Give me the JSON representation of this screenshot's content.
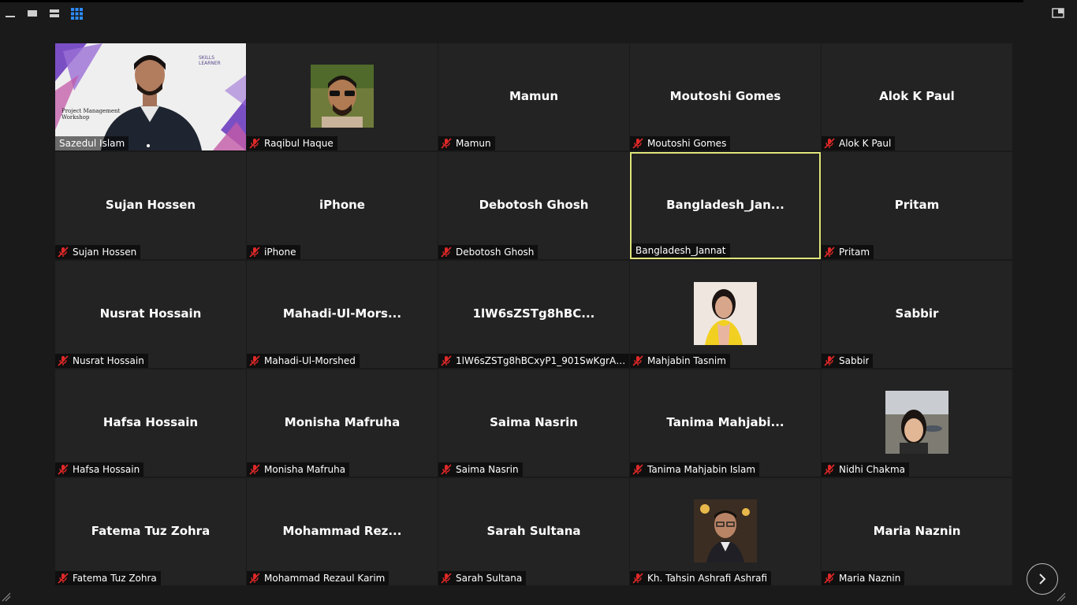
{
  "window": {
    "view_buttons": [
      "minimize-icon",
      "speaker-view-icon",
      "strip-view-icon",
      "gallery-view-icon"
    ],
    "exit_fullscreen_icon": "exit-fullscreen-icon",
    "accent_color": "#2d8cff",
    "active_speaker_border": "#dfe57a"
  },
  "participants": [
    {
      "name": "Sazedul Islam",
      "display": "",
      "kind": "video",
      "muted": false
    },
    {
      "name": "Raqibul Haque",
      "display": "",
      "kind": "photo",
      "muted": true,
      "photo": "man-sunglasses"
    },
    {
      "name": "Mamun",
      "display": "Mamun",
      "kind": "name",
      "muted": true
    },
    {
      "name": "Moutoshi Gomes",
      "display": "Moutoshi Gomes",
      "kind": "name",
      "muted": true
    },
    {
      "name": "Alok K Paul",
      "display": "Alok K Paul",
      "kind": "name",
      "muted": true
    },
    {
      "name": "Sujan Hossen",
      "display": "Sujan Hossen",
      "kind": "name",
      "muted": true
    },
    {
      "name": "iPhone",
      "display": "iPhone",
      "kind": "name",
      "muted": true
    },
    {
      "name": "Debotosh Ghosh",
      "display": "Debotosh Ghosh",
      "kind": "name",
      "muted": true
    },
    {
      "name": "Bangladesh_Jannat",
      "display": "Bangladesh_Jan...",
      "kind": "name",
      "muted": false,
      "active": true
    },
    {
      "name": "Pritam",
      "display": "Pritam",
      "kind": "name",
      "muted": true
    },
    {
      "name": "Nusrat Hossain",
      "display": "Nusrat Hossain",
      "kind": "name",
      "muted": true
    },
    {
      "name": "Mahadi-Ul-Morshed",
      "display": "Mahadi-Ul-Mors...",
      "kind": "name",
      "muted": true
    },
    {
      "name": "1lW6sZSTg8hBCxyP1_901SwKgrARF...",
      "display": "1lW6sZSTg8hBC...",
      "kind": "name",
      "muted": true
    },
    {
      "name": "Mahjabin Tasnim",
      "display": "",
      "kind": "photo",
      "muted": true,
      "photo": "woman-yellow"
    },
    {
      "name": "Sabbir",
      "display": "Sabbir",
      "kind": "name",
      "muted": true
    },
    {
      "name": "Hafsa Hossain",
      "display": "Hafsa Hossain",
      "kind": "name",
      "muted": true
    },
    {
      "name": "Monisha Mafruha",
      "display": "Monisha Mafruha",
      "kind": "name",
      "muted": true
    },
    {
      "name": "Saima Nasrin",
      "display": "Saima Nasrin",
      "kind": "name",
      "muted": true
    },
    {
      "name": "Tanima Mahjabin Islam",
      "display": "Tanima  Mahjabi...",
      "kind": "name",
      "muted": true
    },
    {
      "name": "Nidhi Chakma",
      "display": "",
      "kind": "photo",
      "muted": true,
      "photo": "woman-outdoor"
    },
    {
      "name": "Fatema Tuz Zohra",
      "display": "Fatema Tuz Zohra",
      "kind": "name",
      "muted": true
    },
    {
      "name": "Mohammad Rezaul Karim",
      "display": "Mohammad  Rez...",
      "kind": "name",
      "muted": true
    },
    {
      "name": "Sarah Sultana",
      "display": "Sarah Sultana",
      "kind": "name",
      "muted": true
    },
    {
      "name": "Kh. Tahsin Ashrafi Ashrafi",
      "display": "",
      "kind": "photo",
      "muted": true,
      "photo": "man-glasses"
    },
    {
      "name": "Maria Naznin",
      "display": "Maria Naznin",
      "kind": "name",
      "muted": true
    }
  ],
  "video_slide": {
    "title_line1": "Project Management",
    "title_line2": "Workshop",
    "logo_line1": "SKILLS",
    "logo_line2": "LEARNER"
  },
  "pager": {
    "next_icon": "chevron-right-icon"
  }
}
